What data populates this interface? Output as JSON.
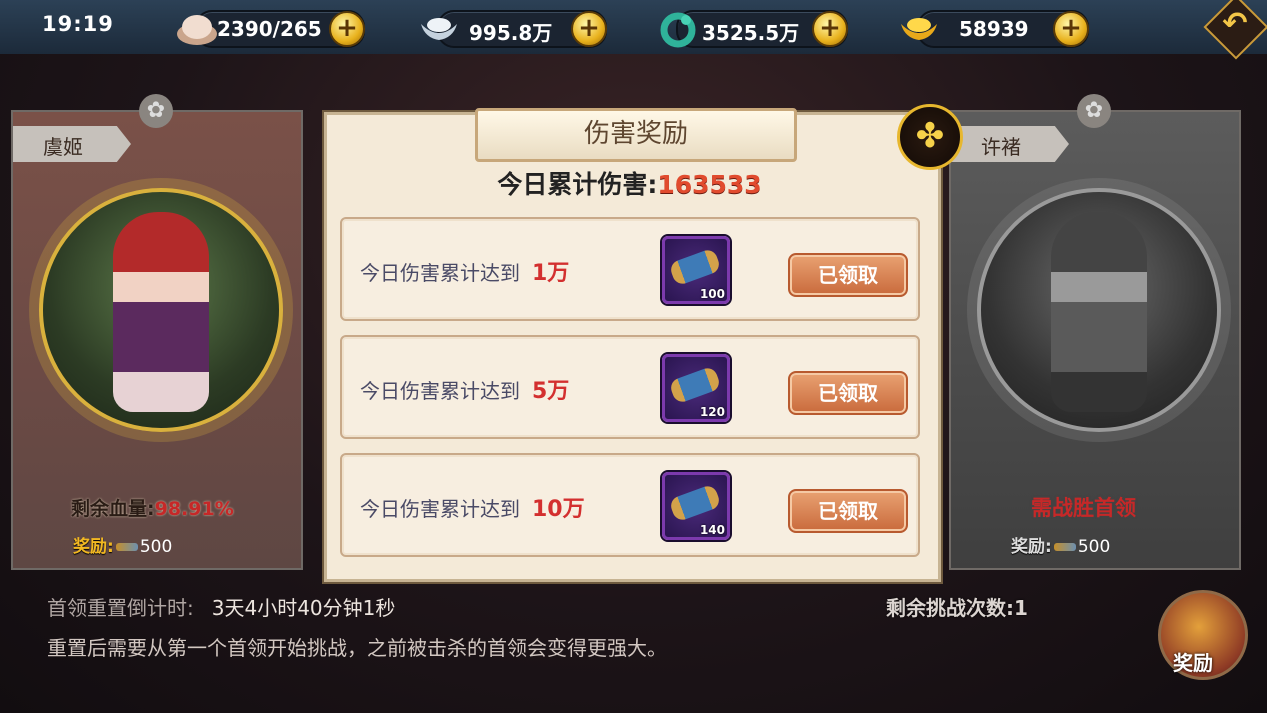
{
  "status": {
    "time": "19:19"
  },
  "resources": [
    {
      "name": "stamina",
      "value": "2390/265",
      "icon": "bun-icon"
    },
    {
      "name": "silver",
      "value": "995.8万",
      "icon": "silver-ingot-icon"
    },
    {
      "name": "jade",
      "value": "3525.5万",
      "icon": "jade-dragon-icon"
    },
    {
      "name": "gold",
      "value": "58939",
      "icon": "gold-ingot-icon"
    }
  ],
  "left_boss": {
    "name": "虞姬",
    "hp_label": "剩余血量:",
    "hp_value": "98.91%",
    "reward_label": "奖励:",
    "reward_value": "500"
  },
  "right_boss": {
    "name": "许褚",
    "locked_text": "需战胜首领",
    "reward_label": "奖励:",
    "reward_value": "500"
  },
  "panel": {
    "title": "伤害奖励",
    "total_label": "今日累计伤害:",
    "total_value": "163533",
    "rows": [
      {
        "text": "今日伤害累计达到",
        "amount": "1万",
        "item_count": "100",
        "button": "已领取"
      },
      {
        "text": "今日伤害累计达到",
        "amount": "5万",
        "item_count": "120",
        "button": "已领取"
      },
      {
        "text": "今日伤害累计达到",
        "amount": "10万",
        "item_count": "140",
        "button": "已领取"
      }
    ]
  },
  "footer": {
    "countdown_label": "首领重置倒计时:",
    "countdown_value": "3天4小时40分钟1秒",
    "tip": "重置后需要从第一个首领开始挑战，之前被击杀的首领会变得更强大。",
    "remaining": "剩余挑战次数:1",
    "reward_button": "奖励"
  },
  "colors": {
    "accent_red": "#d32f2f",
    "gold": "#e7b72e",
    "claimed_button": "#c96a3c"
  }
}
